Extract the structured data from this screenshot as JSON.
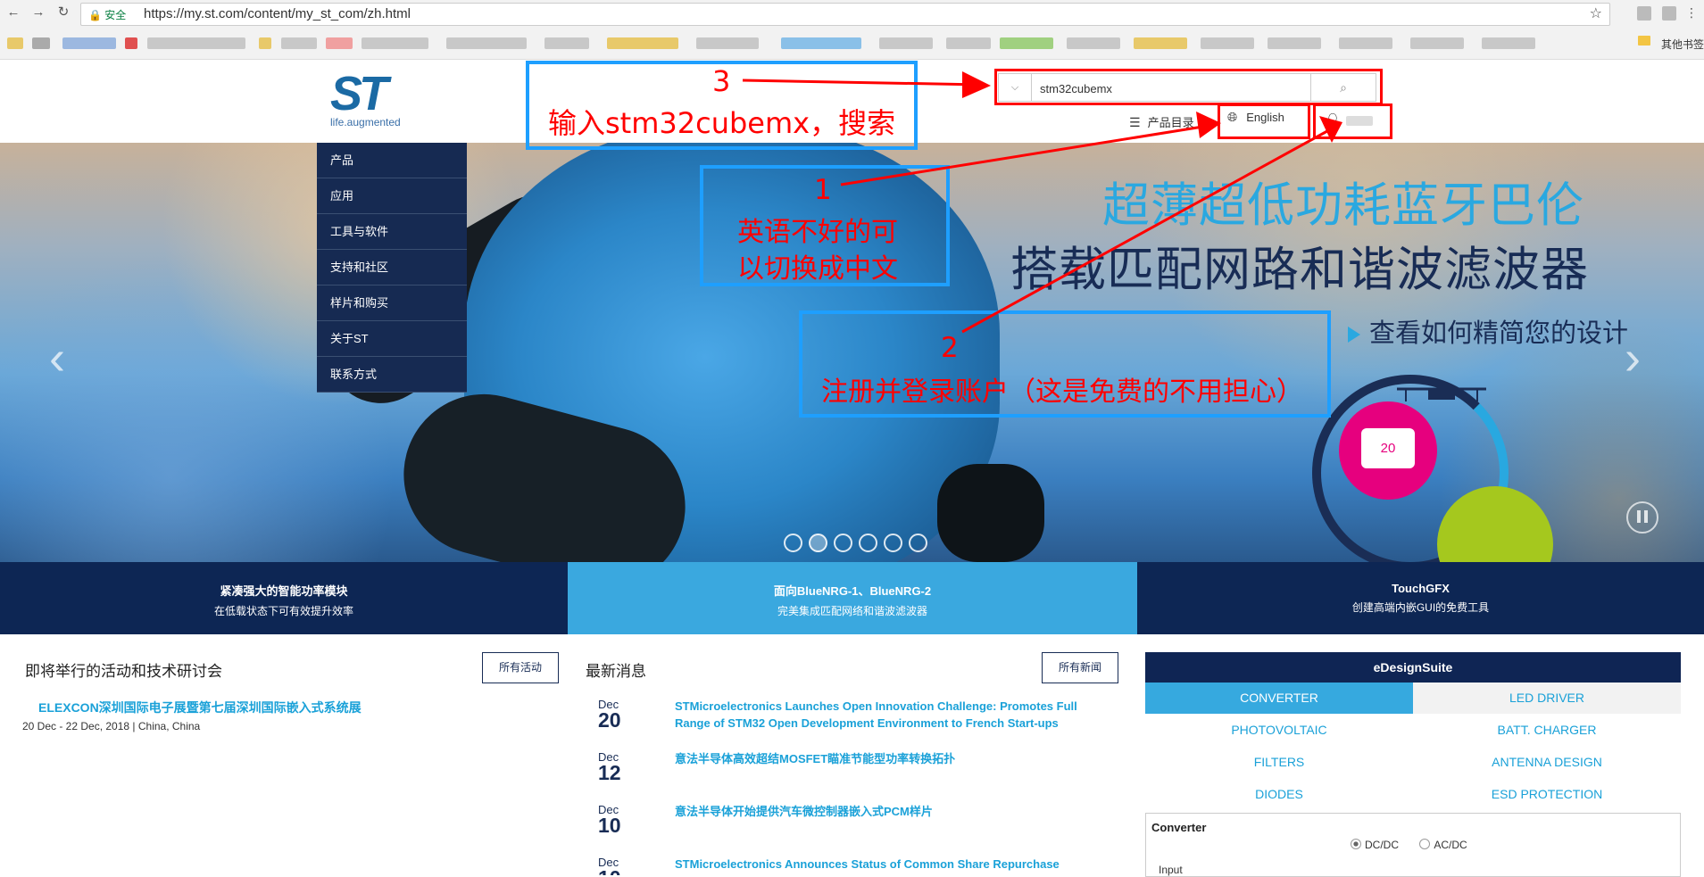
{
  "browser": {
    "secure_label": "安全",
    "url": "https://my.st.com/content/my_st_com/zh.html",
    "other_bookmarks": "其他书签"
  },
  "header": {
    "logo_tagline": "life.augmented",
    "search_value": "stm32cubemx",
    "catalog_label": "产品目录",
    "language_label": "English"
  },
  "menu": {
    "items": [
      "产品",
      "应用",
      "工具与软件",
      "支持和社区",
      "样片和购买",
      "关于ST",
      "联系方式"
    ]
  },
  "hero": {
    "headline_1": "超薄超低功耗蓝牙巴伦",
    "headline_2": "搭载匹配网路和谐波滤波器",
    "link": "查看如何精简您的设计",
    "device_reading": "20"
  },
  "promo": [
    {
      "title": "紧凑强大的智能功率模块",
      "subtitle": "在低载状态下可有效提升效率",
      "color": "#0d2654"
    },
    {
      "title": "面向BlueNRG-1、BlueNRG-2",
      "subtitle": "完美集成匹配网络和谐波滤波器",
      "color": "#3aa8df"
    },
    {
      "title": "TouchGFX",
      "subtitle": "创建高端内嵌GUI的免费工具",
      "color": "#0d2654"
    }
  ],
  "events": {
    "title": "即将举行的活动和技术研讨会",
    "all_button": "所有活动",
    "item_title": "ELEXCON深圳国际电子展暨第七届深圳国际嵌入式系统展",
    "item_meta": "20 Dec - 22 Dec, 2018 | China, China"
  },
  "news": {
    "title": "最新消息",
    "all_button": "所有新闻",
    "items": [
      {
        "month": "Dec",
        "day": "20",
        "text": "STMicroelectronics Launches Open Innovation Challenge: Promotes Full Range of STM32 Open Development Environment to French Start-ups"
      },
      {
        "month": "Dec",
        "day": "12",
        "text": "意法半导体高效超结MOSFET瞄准节能型功率转换拓扑"
      },
      {
        "month": "Dec",
        "day": "10",
        "text": "意法半导体开始提供汽车微控制器嵌入式PCM样片"
      },
      {
        "month": "Dec",
        "day": "10",
        "text": "STMicroelectronics Announces Status of Common Share Repurchase"
      }
    ]
  },
  "edesign": {
    "title": "eDesignSuite",
    "tabs": [
      "CONVERTER",
      "LED DRIVER",
      "PHOTOVOLTAIC",
      "BATT. CHARGER",
      "FILTERS",
      "ANTENNA DESIGN",
      "DIODES",
      "ESD PROTECTION"
    ],
    "active_tab": "CONVERTER",
    "section_label": "Converter",
    "radio_dcdc": "DC/DC",
    "radio_acdc": "AC/DC",
    "selected_radio": "DC/DC",
    "input_label": "Input"
  },
  "annotations": {
    "step3_number": "3",
    "step3_text": "输入stm32cubemx，搜索",
    "step1_number": "1",
    "step1_text_line1": "英语不好的可",
    "step1_text_line2": "以切换成中文",
    "step2_number": "2",
    "step2_text": "注册并登录账户（这是免费的不用担心）"
  },
  "colors": {
    "st_navy": "#0f2554",
    "st_blue": "#3aa8df",
    "link_blue": "#1aa1d8",
    "annotation_red": "#ff0000",
    "annotation_blue": "#1e9fff"
  }
}
